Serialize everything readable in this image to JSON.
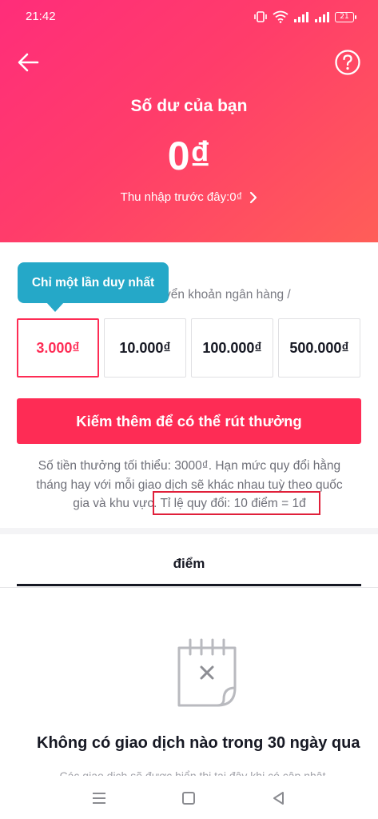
{
  "status_bar": {
    "time": "21:42",
    "battery": "21"
  },
  "header": {
    "balance_title": "Số dư của bạn",
    "balance_value": "0₫",
    "previous_income": "Thu nhập trước đây:0₫"
  },
  "withdraw": {
    "tooltip": "Chỉ một lần duy nhất",
    "bank_transfer_label": "yển khoản ngân hàng /",
    "amounts": [
      "3.000₫",
      "10.000₫",
      "100.000₫",
      "500.000₫"
    ],
    "selected_index": 0,
    "earn_button": "Kiếm thêm để có thể rút thưởng",
    "info_line1": "Số tiền thưởng tối thiểu: 3000₫. Hạn mức quy đổi hằng",
    "info_line2": "tháng hay với mỗi giao dịch sẽ khác nhau tuỳ theo quốc",
    "info_line3_prefix": "gia và khu vực.",
    "info_rate": "Tỉ lệ quy đổi: 10 điểm = 1đ"
  },
  "tabs": {
    "points": "điểm"
  },
  "empty_state": {
    "icon": "empty-calendar-icon",
    "title": "Không có giao dịch nào trong 30 ngày qua",
    "subtitle": "Các giao dịch sẽ được hiển thị tại đây khi có cập nhật"
  },
  "colors": {
    "accent": "#fe2c55",
    "tooltip": "#25a8c8",
    "highlight": "#e0203a"
  }
}
